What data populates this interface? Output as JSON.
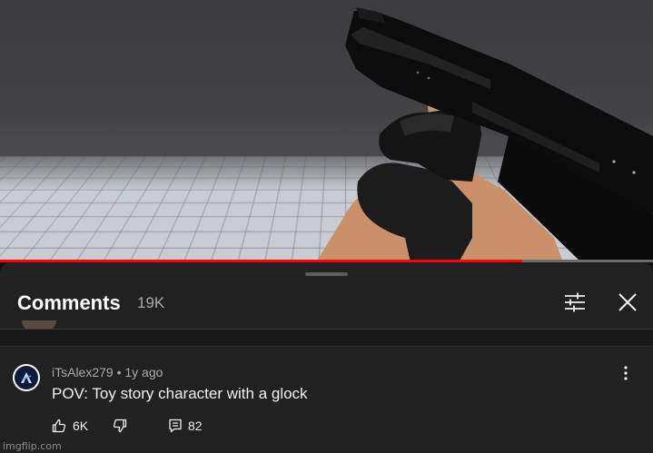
{
  "video": {
    "progress_fraction": 0.8,
    "scene": "first-person view of a gloved hand holding a black pistol over a grid floor"
  },
  "comments_panel": {
    "title": "Comments",
    "count": "19K",
    "filter_icon": "filter-sliders-icon",
    "close_icon": "close-icon"
  },
  "comment": {
    "author": "iTsAlex279",
    "time": "• 1y ago",
    "text": "POV: Toy story character with a glock",
    "likes": "6K",
    "replies": "82",
    "icons": {
      "like": "thumbs-up-icon",
      "dislike": "thumbs-down-icon",
      "reply": "reply-icon",
      "more": "more-vertical-icon"
    }
  },
  "watermark": "imgflip.com",
  "colors": {
    "progress": "#ff0000",
    "sheet_bg": "#212121",
    "muted_text": "#aaaaaa"
  }
}
